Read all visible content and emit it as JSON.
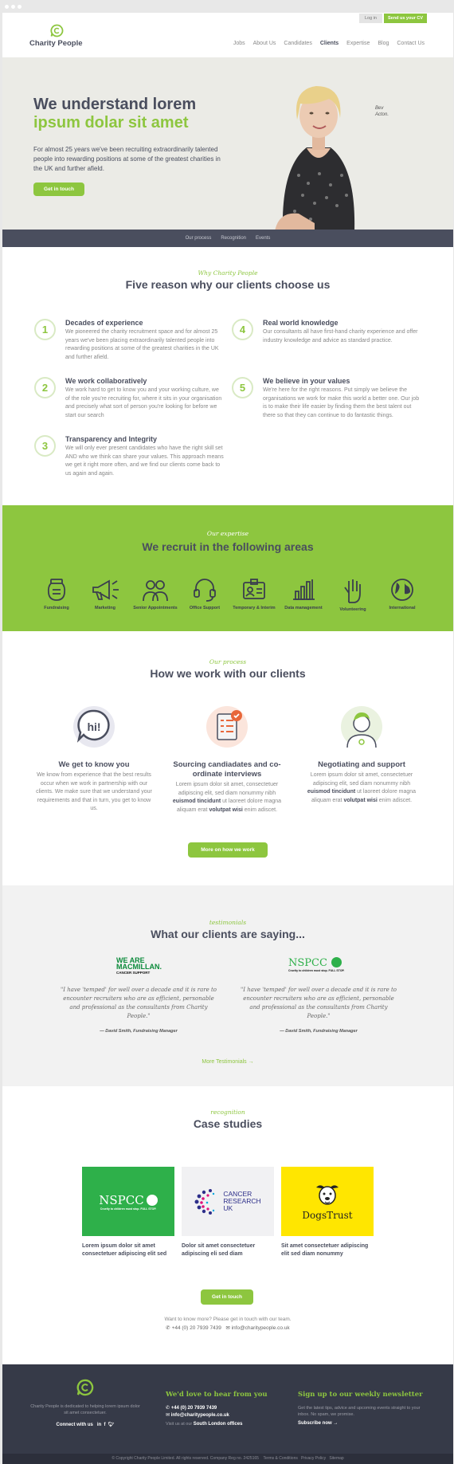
{
  "header": {
    "login": "Log in",
    "send_cv": "Send us your CV",
    "logo_text": "Charity People",
    "nav": [
      "Jobs",
      "About Us",
      "Candidates",
      "Clients",
      "Expertise",
      "Blog",
      "Contact Us"
    ],
    "active_nav": "Clients"
  },
  "hero": {
    "title_line1": "We understand lorem",
    "title_line2": "ipsum dolar sit amet",
    "text": "For almost 25 years we've been recruiting extraordinarily talented people into rewarding positions at some of the greatest charities in the UK and further afield.",
    "cta": "Get in touch",
    "signature_line1": "Bev",
    "signature_line2": "Acton."
  },
  "subnav": [
    "Our process",
    "Recognition",
    "Events"
  ],
  "reasons": {
    "kicker": "Why Charity People",
    "title": "Five reason why our clients choose us",
    "items": [
      {
        "num": "1",
        "title": "Decades of experience",
        "text": "We pioneered the charity recruitment space and for almost 25 years we've been placing extraordinarily talented people into rewarding positions at some of the greatest charities in the UK and further afield."
      },
      {
        "num": "2",
        "title": "We work collaboratively",
        "text": "We work hard to get to know you and your working culture, we of the role you're recruiting for, where it sits in your organisation and precisely what sort of person you're looking for before we start our search"
      },
      {
        "num": "3",
        "title": "Transparency and Integrity",
        "text": "We will only ever present candidates who have the right skill set AND who we think can share your values. This approach means we get it right more often, and we find our clients come back to us again and again."
      },
      {
        "num": "4",
        "title": "Real world knowledge",
        "text": "Our consultants all have first-hand charity experience and offer industry knowledge and advice as standard practice."
      },
      {
        "num": "5",
        "title": "We believe in your values",
        "text": "We're here for the right reasons. Put simply we believe the organisations we work for make this world a better one. Our job is to make their life easier by finding them the best talent out there so that they can continue to do fantastic things."
      }
    ]
  },
  "expertise": {
    "kicker": "Our expertise",
    "title": "We recruit in the following areas",
    "areas": [
      {
        "label": "Fundraising",
        "icon": "jar-icon"
      },
      {
        "label": "Marketing",
        "icon": "megaphone-icon"
      },
      {
        "label": "Senior Appointments",
        "icon": "people-icon"
      },
      {
        "label": "Office Support",
        "icon": "headset-icon"
      },
      {
        "label": "Temporary & Interim",
        "icon": "id-badge-icon"
      },
      {
        "label": "Data management",
        "icon": "bar-chart-icon"
      },
      {
        "label": "Volunteering",
        "icon": "raised-hand-icon"
      },
      {
        "label": "International",
        "icon": "globe-icon"
      }
    ]
  },
  "process": {
    "kicker": "Our process",
    "title": "How we work with our clients",
    "steps": [
      {
        "title": "We get to know you",
        "text": "We know from experience that the best results occur when we work in partnership with our clients. We make sure that we understand your requirements and that in turn, you get to know us.",
        "icon": "speech-bubble-icon"
      },
      {
        "title": "Sourcing candiadates and co-ordinate interviews",
        "text_a": "Lorem ipsum dolor sit amet, consectetuer adipiscing elit, sed diam nonummy nibh ",
        "bold_a": "euismod tincidunt",
        "text_b": " ut laoreet dolore magna aliquam erat ",
        "bold_b": "volutpat wisi",
        "text_c": " enim adiscet.",
        "icon": "checklist-icon"
      },
      {
        "title": "Negotiating and support",
        "text_a": "Lorem ipsum dolor sit amet, consectetuer adipiscing elit, sed diam nonummy nibh ",
        "bold_a": "euismod tincidunt",
        "text_b": " ut laoreet dolore magna aliquam erat ",
        "bold_b": "volutpat wisi",
        "text_c": " enim adiscet.",
        "icon": "consultant-icon"
      }
    ],
    "cta": "More on how we work"
  },
  "testimonials": {
    "kicker": "testimonials",
    "title": "What our clients are saying...",
    "items": [
      {
        "logo_line1": "WE ARE",
        "logo_line2": "MACMILLAN.",
        "logo_line3": "CANCER SUPPORT",
        "quote": "\"I have 'temped' for well over a decade and it is rare to encounter recruiters who are as efficient, personable and professional as the consultants from Charity People.\"",
        "cite": "— David Smith, Fundraising Manager"
      },
      {
        "logo_line1": "NSPCC",
        "logo_line2": "Cruelty to children must stop. FULL STOP.",
        "quote": "\"I have 'temped' for well over a decade and it is rare to encounter recruiters who are as efficient, personable and professional as the consultants from Charity People.\"",
        "cite": "— David Smith, Fundraising Manager"
      }
    ],
    "more": "More Testimonials"
  },
  "cases": {
    "kicker": "recognition",
    "title": "Case studies",
    "items": [
      {
        "logo": "NSPCC",
        "logo_sub": "Cruelty to children must stop. FULL STOP.",
        "caption": "Lorem ipsum dolor sit amet consectetuer adipiscing elit sed"
      },
      {
        "logo_line1": "CANCER",
        "logo_line2": "RESEARCH",
        "logo_line3": "UK",
        "caption": "Dolor sit amet consectetuer adipiscing eli sed diam"
      },
      {
        "logo": "DogsTrust",
        "caption": "Sit amet consectetuer adipiscing elit sed diam nonummy"
      }
    ],
    "cta": "Get in touch",
    "contact_text": "Want to know more? Please get in touch with our team.",
    "phone": "+44 (0) 20 7939 7439",
    "email": "info@charitypeople.co.uk"
  },
  "footer": {
    "about": "Charity People is dedicated to helping lorem ipsum dolor sit amet consectetuer.",
    "connect": "Connect with us",
    "hear_title": "We'd love to hear from you",
    "phone": "+44 (0) 20 7939 7439",
    "email": "info@charitypeople.co.uk",
    "visit_prefix": "Visit us at our ",
    "visit_link": "South London offices",
    "news_title": "Sign up to our weekly newsletter",
    "news_text": "Get the latest tips, advice and upcoming events straight to your inbox. No spam, we promise.",
    "subscribe": "Subscribe now",
    "copyright": "© Copyright Charity People Limited. All rights reserved. Company Reg no. 2425165",
    "links": [
      "Terms & Conditions",
      "Privacy Policy",
      "Sitemap"
    ]
  },
  "colors": {
    "green": "#8dc63f",
    "navy": "#4a4e5e",
    "footer": "#363a48",
    "nspcc": "#2eb04a",
    "dogs": "#ffe600"
  }
}
